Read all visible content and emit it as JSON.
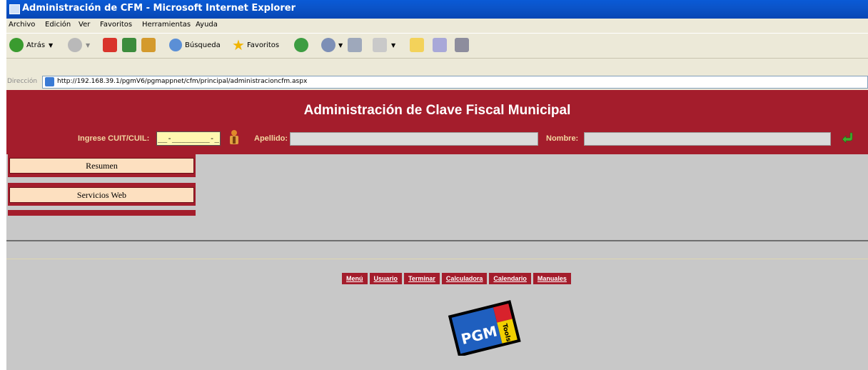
{
  "window": {
    "title": "Administración de CFM - Microsoft Internet Explorer"
  },
  "menu": [
    "Archivo",
    "Edición",
    "Ver",
    "Favoritos",
    "Herramientas",
    "Ayuda"
  ],
  "toolbar": {
    "back_label": "Atrás",
    "search_label": "Búsqueda",
    "favorites_label": "Favoritos"
  },
  "address": {
    "label": "Dirección",
    "url": "http://192.168.39.1/pgmV6/pgmappnet/cfm/principal/administracioncfm.aspx"
  },
  "page": {
    "title": "Administración de Clave Fiscal Municipal",
    "cuit_label": "Ingrese CUIT/CUIL:",
    "cuit_value": "__-________-_",
    "apellido_label": "Apellido:",
    "nombre_label": "Nombre:",
    "sidebar": [
      "Resumen",
      "Servicios Web"
    ],
    "nav_links": [
      "Menú",
      "Usuario",
      "Terminar",
      "Calculadora",
      "Calendario",
      "Manuales"
    ],
    "logo": {
      "text": "PGM",
      "subtext": "Tools"
    }
  },
  "colors": {
    "brand": "#a41d2c",
    "menu_item_bg": "#fde0c0",
    "cuit_bg": "#fff7b0",
    "label": "#f2d7a0"
  }
}
